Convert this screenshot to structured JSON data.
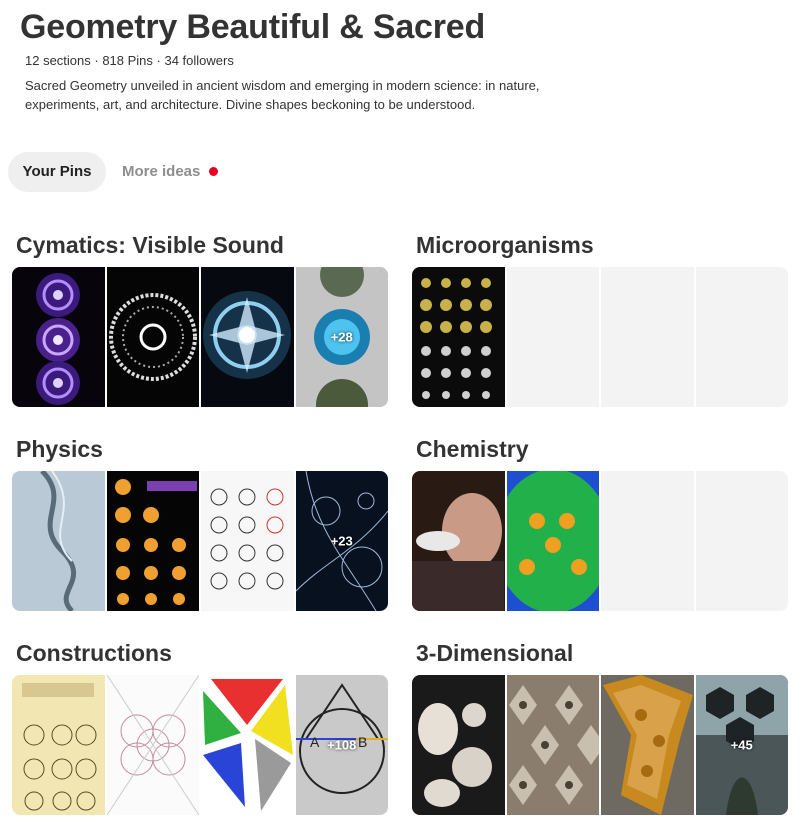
{
  "board": {
    "title": "Geometry Beautiful & Sacred",
    "meta": "12 sections · 818 Pins · 34 followers",
    "description": "Sacred Geometry unveiled in ancient wisdom and emerging in modern science: in nature, experiments, art, and architecture. Divine shapes beckoning to be understood."
  },
  "tabs": [
    {
      "label": "Your Pins",
      "selected": true
    },
    {
      "label": "More ideas",
      "selected": false,
      "notification_dot": "#e60023"
    }
  ],
  "sections": [
    {
      "title": "Cymatics: Visible Sound",
      "more_count": "+28"
    },
    {
      "title": "Microorganisms",
      "more_count": ""
    },
    {
      "title": "Physics",
      "more_count": "+23"
    },
    {
      "title": "Chemistry",
      "more_count": ""
    },
    {
      "title": "Constructions",
      "more_count": "+108",
      "thumb_letters": [
        "A",
        "B"
      ]
    },
    {
      "title": "3-Dimensional",
      "more_count": "+45"
    }
  ]
}
